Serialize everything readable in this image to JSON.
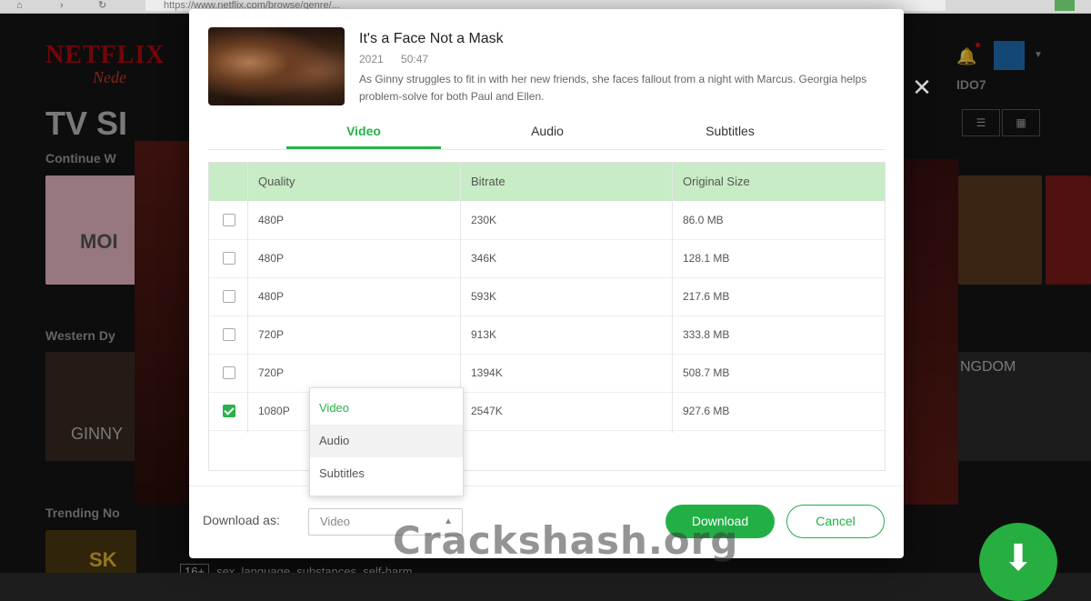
{
  "browser": {
    "url": "https://www.netflix.com/browse/genre/...",
    "back_icon": "back-arrow-icon",
    "reload_icon": "reload-icon",
    "lock_icon": "lock-icon"
  },
  "background": {
    "logo": "NETFLIX",
    "logo_sub": "Nede",
    "heading": "TV SI",
    "rows": [
      "Continue W",
      "Western Dy",
      "Trending No"
    ],
    "right_text_1": "IDO7",
    "right_text_2": "NGDOM",
    "thumb_text_1": "MOI",
    "thumb_text_2": "GINNY",
    "thumb_text_3": "SK",
    "maturity_age": "16+",
    "maturity_tags": "sex, language, substances, self-harm",
    "accent": "#b20710"
  },
  "modal": {
    "close_icon": "close-icon",
    "title": "It's a Face Not a Mask",
    "year": "2021",
    "duration": "50:47",
    "description": "As Ginny struggles to fit in with her new friends, she faces fallout from a night with Marcus. Georgia helps problem-solve for both Paul and Ellen.",
    "tabs": [
      {
        "label": "Video",
        "active": true
      },
      {
        "label": "Audio",
        "active": false
      },
      {
        "label": "Subtitles",
        "active": false
      }
    ],
    "table": {
      "headers": [
        "Quality",
        "Bitrate",
        "Original Size"
      ],
      "rows": [
        {
          "quality": "480P",
          "bitrate": "230K",
          "size": "86.0 MB",
          "checked": false
        },
        {
          "quality": "480P",
          "bitrate": "346K",
          "size": "128.1 MB",
          "checked": false
        },
        {
          "quality": "480P",
          "bitrate": "593K",
          "size": "217.6 MB",
          "checked": false
        },
        {
          "quality": "720P",
          "bitrate": "913K",
          "size": "333.8 MB",
          "checked": false
        },
        {
          "quality": "720P",
          "bitrate": "1394K",
          "size": "508.7 MB",
          "checked": false
        },
        {
          "quality": "1080P",
          "bitrate": "2547K",
          "size": "927.6 MB",
          "checked": true
        }
      ]
    },
    "download_as_label": "Download as:",
    "download_as_value": "Video",
    "dropdown_options": [
      "Video",
      "Audio",
      "Subtitles"
    ],
    "download_button": "Download",
    "cancel_button": "Cancel",
    "accent": "#22b046"
  },
  "watermark": "Crackshash.org"
}
